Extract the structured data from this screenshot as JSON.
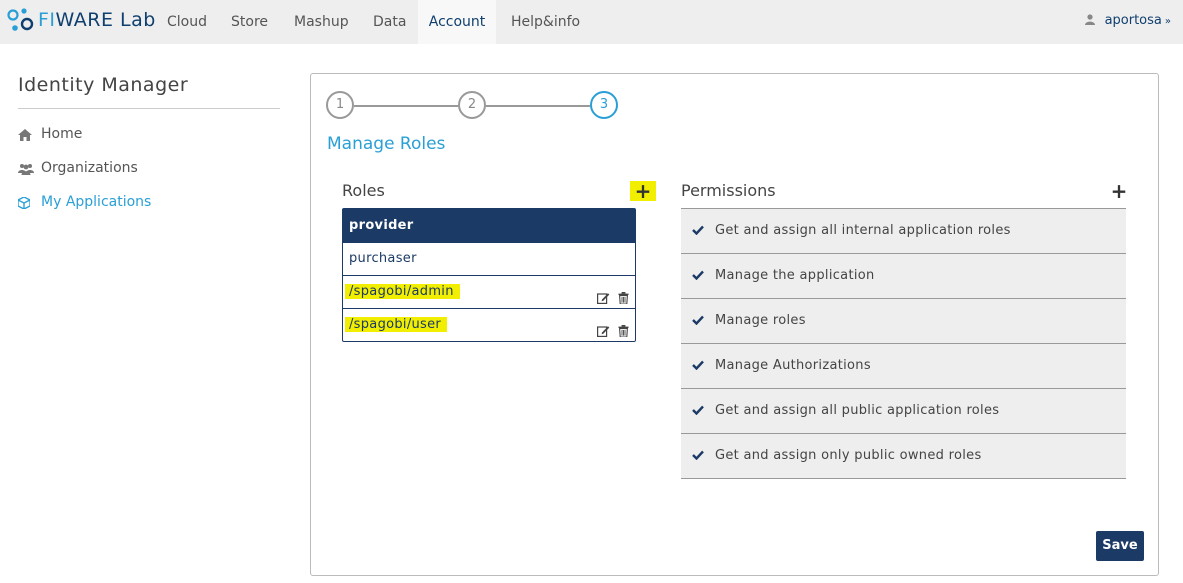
{
  "brand": {
    "prefix": "FI",
    "middle": "WARE",
    "suffix": " Lab"
  },
  "nav": {
    "items": [
      {
        "label": "Cloud"
      },
      {
        "label": "Store"
      },
      {
        "label": "Mashup"
      },
      {
        "label": "Data"
      },
      {
        "label": "Account"
      },
      {
        "label": "Help&info"
      }
    ],
    "active": "Account",
    "user": {
      "name": "aportosa",
      "icon": "user-icon"
    }
  },
  "sidebar": {
    "title": "Identity Manager",
    "items": [
      {
        "label": "Home",
        "icon": "home-icon"
      },
      {
        "label": "Organizations",
        "icon": "group-icon"
      },
      {
        "label": "My Applications",
        "icon": "cube-icon"
      }
    ],
    "active": "My Applications"
  },
  "wizard": {
    "steps": [
      "1",
      "2",
      "3"
    ],
    "current_step": "3",
    "title": "Manage Roles"
  },
  "roles": {
    "title": "Roles",
    "add_label": "+",
    "items": [
      {
        "name": "provider",
        "selected": true
      },
      {
        "name": "purchaser"
      },
      {
        "name": "/spagobi/admin",
        "highlighted": true,
        "editable": true
      },
      {
        "name": "/spagobi/user",
        "highlighted": true,
        "editable": true
      }
    ]
  },
  "permissions": {
    "title": "Permissions",
    "add_label": "+",
    "items": [
      {
        "label": "Get and assign all internal application roles",
        "checked": true
      },
      {
        "label": "Manage the application",
        "checked": true
      },
      {
        "label": "Manage roles",
        "checked": true
      },
      {
        "label": "Manage Authorizations",
        "checked": true
      },
      {
        "label": "Get and assign all public application roles",
        "checked": true
      },
      {
        "label": "Get and assign only public owned roles",
        "checked": true
      }
    ]
  },
  "actions": {
    "save_label": "Save"
  },
  "colors": {
    "navy": "#1b3a66",
    "accent": "#2a9fd6",
    "highlight": "#f2ee00",
    "navbar_bg": "#eeeeee"
  }
}
